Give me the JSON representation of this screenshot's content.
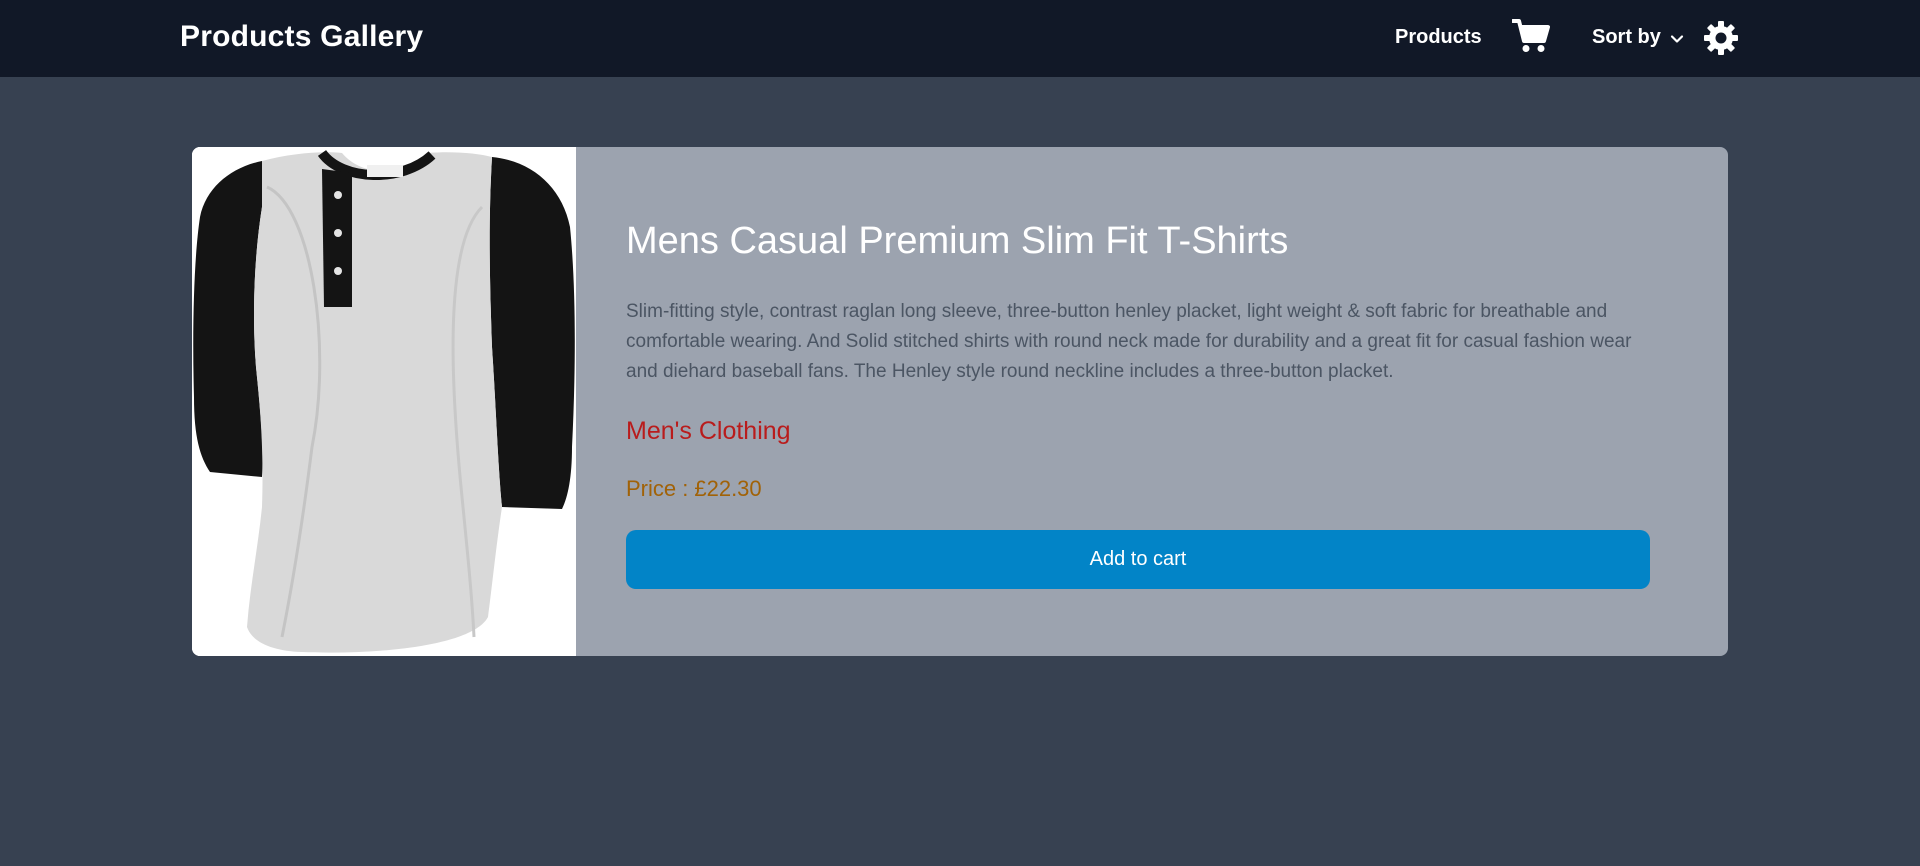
{
  "navbar": {
    "brand": "Products Gallery",
    "products_link": "Products",
    "sort_by_label": "Sort by",
    "icons": [
      "cart-icon",
      "chevron-down-icon",
      "settings-icon"
    ]
  },
  "product": {
    "title": "Mens Casual Premium Slim Fit T-Shirts",
    "description": "Slim-fitting style, contrast raglan long sleeve, three-button henley placket, light weight & soft fabric for breathable and comfortable wearing. And Solid stitched shirts with round neck made for durability and a great fit for casual fashion wear and diehard baseball fans. The Henley style round neckline includes a three-button placket.",
    "category": "Men's Clothing",
    "price_label": "Price :",
    "price_value": "£22.30",
    "add_to_cart_label": "Add to cart"
  },
  "colors": {
    "navbar_bg": "#111827",
    "page_bg": "#374151",
    "card_bg": "#9ca3af",
    "category": "#b91c1c",
    "price": "#a16207",
    "button": "#0284c7"
  }
}
